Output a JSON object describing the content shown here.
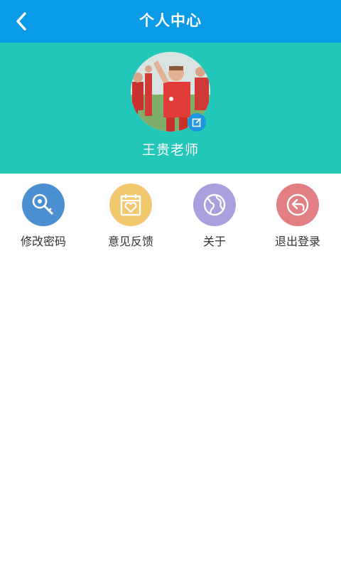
{
  "header": {
    "title": "个人中心",
    "back_icon": "chevron-left-icon",
    "background": "#0a9be6"
  },
  "profile": {
    "name": "王贵老师",
    "avatar": "profile-photo",
    "edit_icon": "edit-icon",
    "background": "#22c7b8"
  },
  "menu": {
    "items": [
      {
        "label": "修改密码",
        "icon": "key-icon",
        "color": "#4a8fd0"
      },
      {
        "label": "意见反馈",
        "icon": "feedback-heart-icon",
        "color": "#f2c86e"
      },
      {
        "label": "关于",
        "icon": "globe-icon",
        "color": "#ac9fde"
      },
      {
        "label": "退出登录",
        "icon": "logout-icon",
        "color": "#e27f82"
      }
    ]
  }
}
